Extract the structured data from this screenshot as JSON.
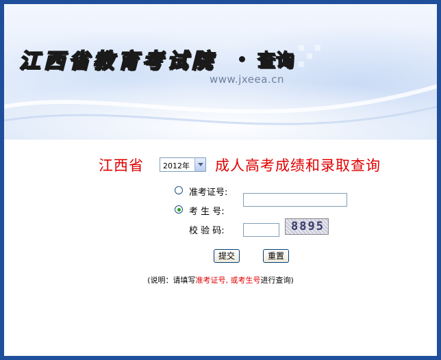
{
  "banner": {
    "title": "江西省教育考试院",
    "subtitle": "查询",
    "url": "www.jxeea.cn"
  },
  "heading": {
    "province": "江西省",
    "year_selected": "2012年",
    "title": "成人高考成绩和录取查询"
  },
  "form": {
    "options": [
      {
        "label": "准考证号:",
        "selected": false
      },
      {
        "label": "考 生 号:",
        "selected": true
      }
    ],
    "captcha_label": "校 验 码:",
    "captcha_value": "8895",
    "submit_label": "提交",
    "reset_label": "重置"
  },
  "note": {
    "prefix": "(说明：请填写",
    "highlight": "准考证号, 或考生号",
    "suffix": "进行查询)"
  },
  "colors": {
    "page_border": "#1f4f9a",
    "accent_red": "#e00000",
    "radio_selected": "#21a121"
  }
}
